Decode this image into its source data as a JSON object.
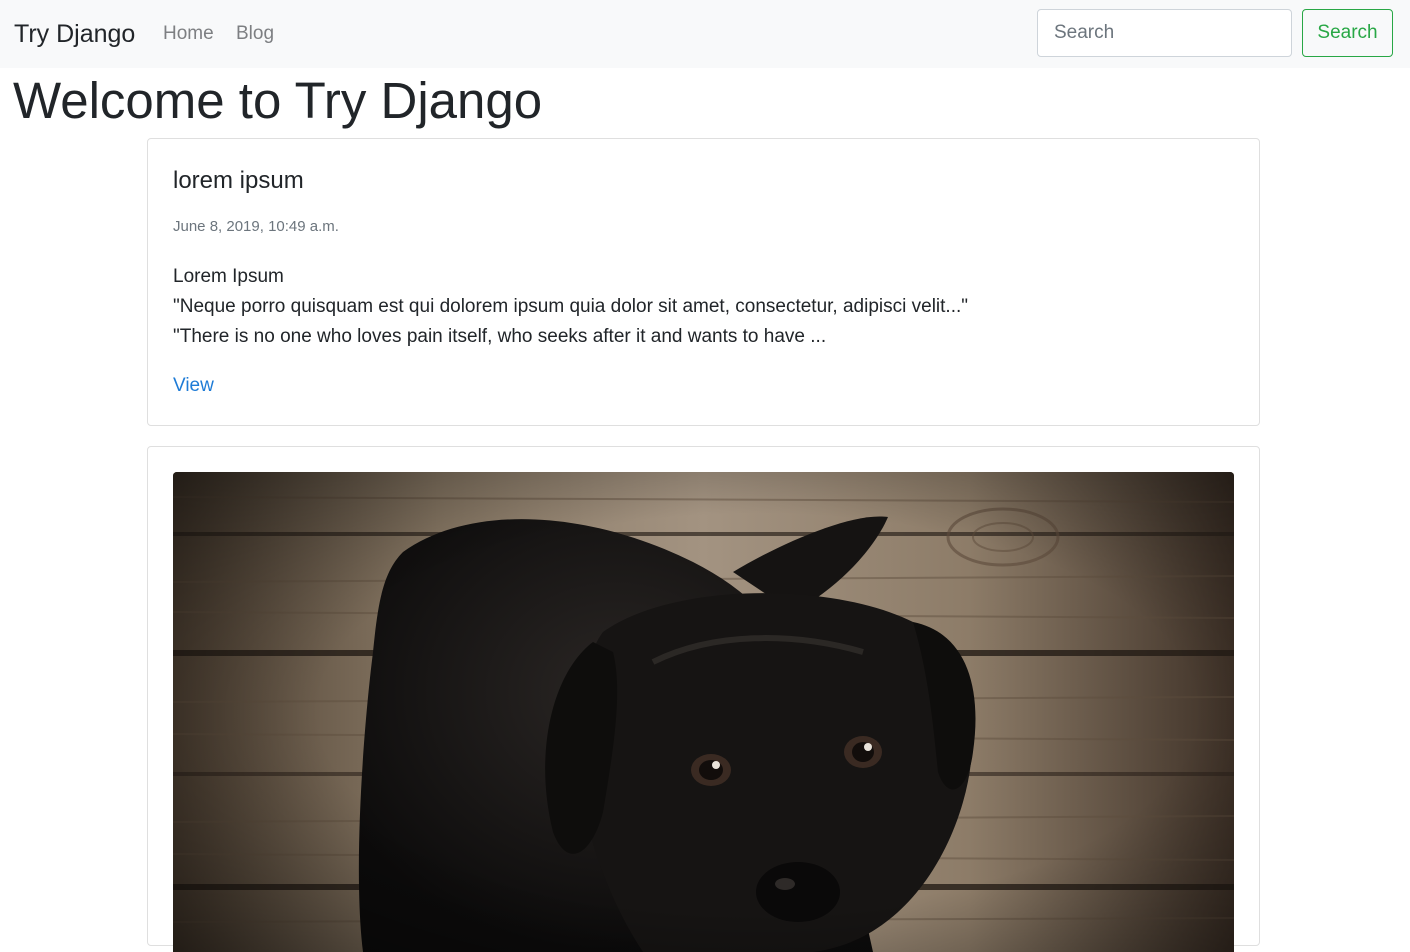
{
  "navbar": {
    "brand": "Try Django",
    "links": [
      {
        "label": "Home"
      },
      {
        "label": "Blog"
      }
    ],
    "search": {
      "placeholder": "Search",
      "value": "",
      "button_label": "Search"
    }
  },
  "page": {
    "title": "Welcome to Try Django"
  },
  "posts": [
    {
      "title": "lorem ipsum",
      "date": "June 8, 2019, 10:49 a.m.",
      "body_lines": [
        "Lorem Ipsum",
        "\"Neque porro quisquam est qui dolorem ipsum quia dolor sit amet, consectetur, adipisci velit...\"",
        "\"There is no one who loves pain itself, who seeks after it and wants to have ..."
      ],
      "link_label": "View"
    },
    {
      "image_subject": "black-puppy-on-wooden-floor"
    }
  ],
  "colors": {
    "navbar_bg": "#f8f9fa",
    "link": "#1e7bd6",
    "success": "#28a745",
    "muted": "#6c757d"
  }
}
